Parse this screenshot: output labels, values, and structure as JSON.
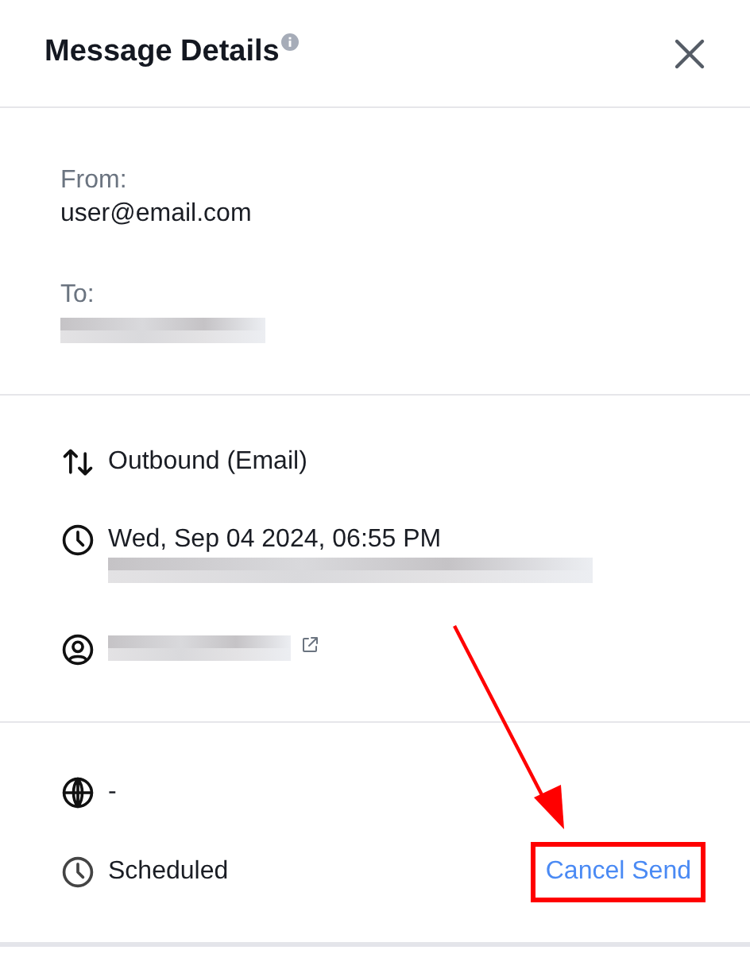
{
  "header": {
    "title": "Message Details"
  },
  "participants": [
    {
      "label": "From:",
      "value": "user@email.com",
      "kind": "text"
    },
    {
      "label": "To:",
      "kind": "redacted"
    }
  ],
  "details": [
    {
      "value": "Outbound (Email)",
      "kind": "text"
    },
    {
      "value": "Wed, Sep 04 2024, 06:55 PM",
      "kind": "text_redacted"
    },
    {
      "kind": "redacted_link"
    }
  ],
  "status": {
    "language": "-",
    "state": "Scheduled",
    "action": "Cancel Send",
    "action_highlighted": true
  },
  "annotation": {
    "kind": "arrow"
  }
}
